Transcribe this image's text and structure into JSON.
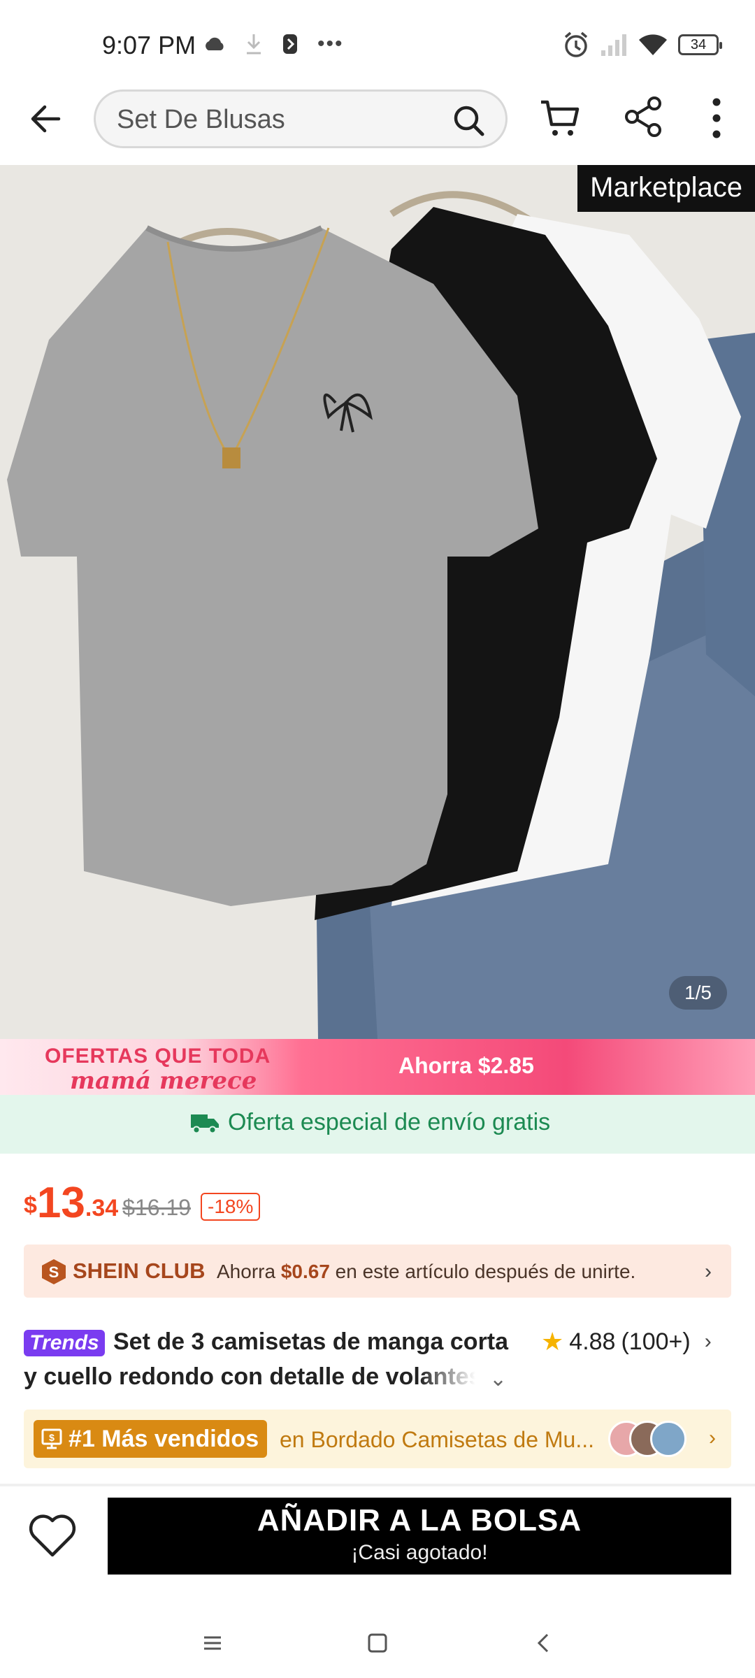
{
  "status_bar": {
    "time": "9:07 PM",
    "battery_level": "34",
    "icons": [
      "cloud-icon",
      "download-icon",
      "app-icon",
      "more-dots-icon",
      "alarm-icon",
      "signal-icon",
      "wifi-icon",
      "battery-icon"
    ]
  },
  "header": {
    "search_value": "Set De Blusas",
    "icons": [
      "back-arrow-icon",
      "search-icon",
      "cart-icon",
      "share-icon",
      "more-vertical-icon"
    ]
  },
  "gallery": {
    "badge": "Marketplace",
    "pager": "1/5"
  },
  "promo": {
    "headline": "OFERTAS QUE TODA",
    "script": "mamá merece",
    "savings": "Ahorra $2.85"
  },
  "shipping": {
    "text": "Oferta especial de envío gratis"
  },
  "price": {
    "currency": "$",
    "integer": "13",
    "decimal": ".34",
    "original": "$16.19",
    "discount": "-18%"
  },
  "club": {
    "name": "SHEIN CLUB",
    "prefix": "Ahorra ",
    "amount": "$0.67",
    "suffix": " en este artículo después de unirte."
  },
  "product": {
    "trends_badge": "Trends",
    "title_line1": "Set de 3 camisetas de manga corta",
    "title_line2": "y cuello redondo con detalle de volantes,",
    "rating": "4.88",
    "review_count": "(100+)"
  },
  "bestseller": {
    "badge": "#1 Más vendidos",
    "text": "en Bordado Camisetas de Mu..."
  },
  "actions": {
    "add_to_bag": "AÑADIR A LA BOLSA",
    "stock_note": "¡Casi agotado!"
  },
  "colors": {
    "price_accent": "#f34620",
    "shipping_green": "#1c8a52",
    "club_brown": "#a6461c",
    "bestseller_gold": "#d98a13",
    "trends_purple": "#7a3cf0"
  }
}
